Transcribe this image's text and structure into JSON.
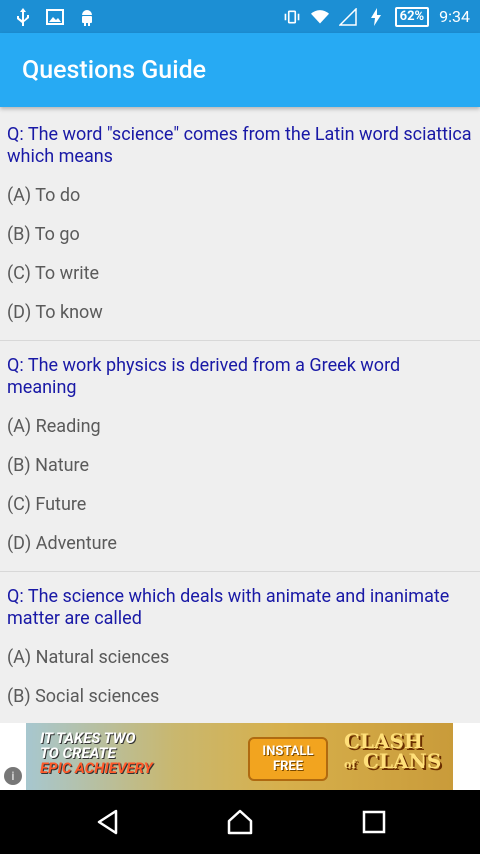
{
  "status_bar": {
    "battery": "62%",
    "time": "9:34",
    "icons": [
      "usb-icon",
      "image-icon",
      "android-icon",
      "vibrate-icon",
      "wifi-icon",
      "signal-icon",
      "charging-icon",
      "battery-icon"
    ]
  },
  "app_bar": {
    "title": "Questions Guide"
  },
  "questions": [
    {
      "question": "Q: The word \"science\" comes from the Latin word sciattica which means",
      "options": [
        "(A) To do",
        "(B) To go",
        "(C) To write",
        "(D) To know"
      ]
    },
    {
      "question": "Q: The work physics is derived from a Greek word meaning",
      "options": [
        "(A) Reading",
        "(B) Nature",
        "(C) Future",
        "(D) Adventure"
      ]
    },
    {
      "question": "Q: The science which deals with animate and inanimate matter are called",
      "options": [
        "(A) Natural sciences",
        "(B) Social sciences"
      ]
    }
  ],
  "ad": {
    "line1": "IT TAKES TWO",
    "line2": "TO CREATE",
    "line3": "EPIC ACHIEVERY",
    "cta_line1": "INSTALL",
    "cta_line2": "FREE",
    "logo_line1": "CLASH",
    "logo_of": "of",
    "logo_line2": "CLANS",
    "info": "i"
  },
  "nav": {
    "buttons": [
      "back-icon",
      "home-icon",
      "recents-icon"
    ]
  },
  "colors": {
    "status_bar": "#1c8fd4",
    "app_bar": "#27aaf3",
    "question_text": "#1919a6"
  }
}
